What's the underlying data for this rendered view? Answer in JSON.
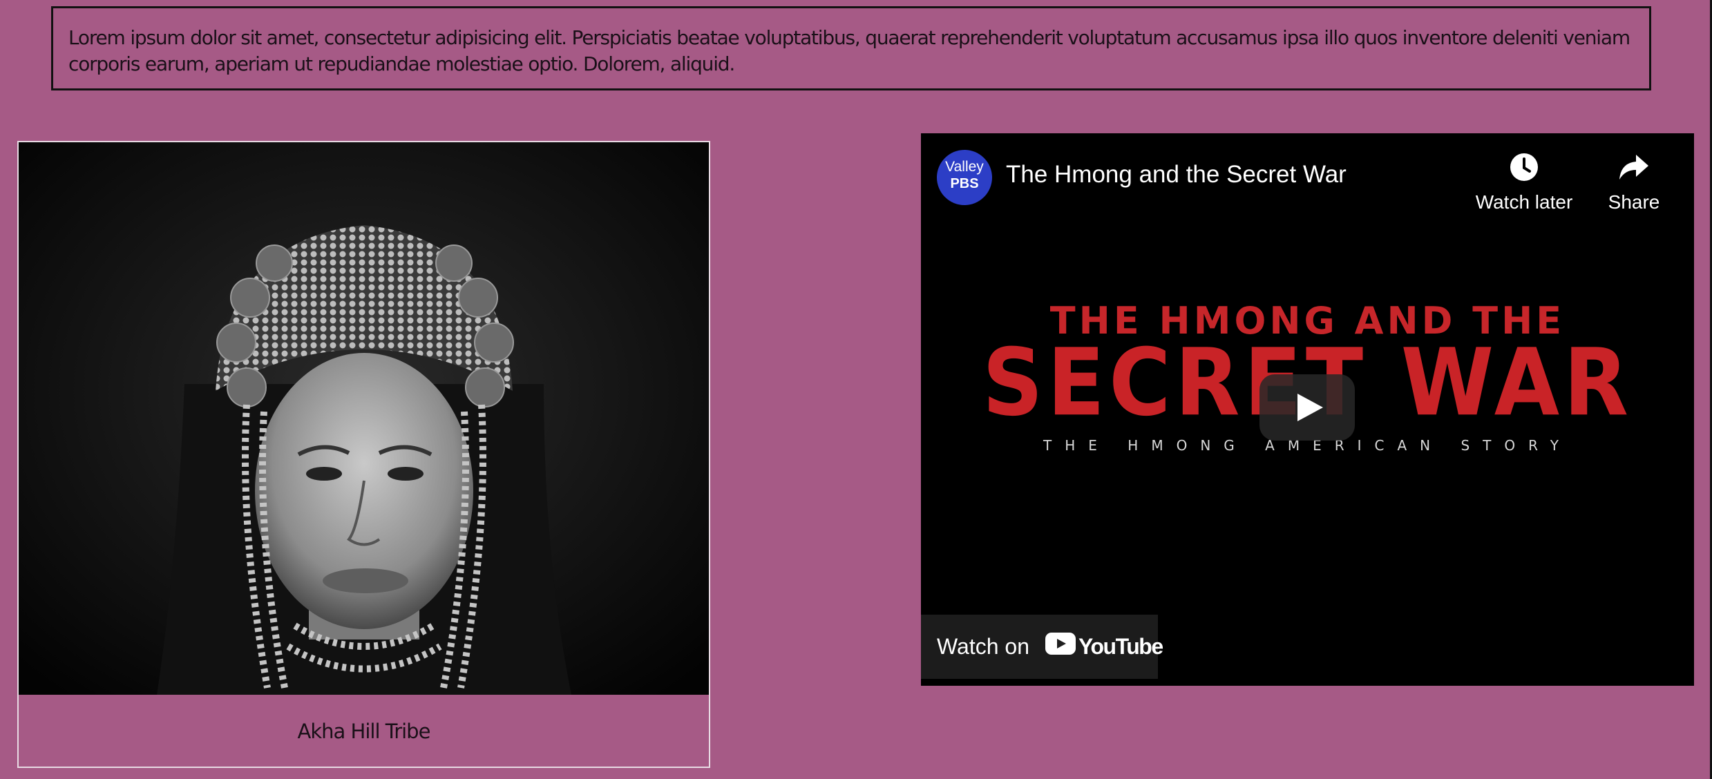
{
  "intro": {
    "text": "Lorem ipsum dolor sit amet, consectetur adipisicing elit. Perspiciatis beatae voluptatibus, quaerat reprehenderit voluptatum accusamus ipsa illo quos inventore deleniti veniam corporis earum, aperiam ut repudiandae molestiae optio. Dolorem, aliquid."
  },
  "figure": {
    "photo_subject": "black and white portrait of a woman in a beaded Akha headdress",
    "caption": "Akha Hill Tribe"
  },
  "video": {
    "channel_logo_line1": "Valley",
    "channel_logo_line2": "PBS",
    "title": "The Hmong and the Secret War",
    "watch_later_label": "Watch later",
    "share_label": "Share",
    "poster_line1": "THE HMONG AND THE",
    "poster_line2": "SECRET WAR",
    "poster_line3": "THE HMONG AMERICAN STORY",
    "watch_on_label": "Watch on",
    "youtube_label": "YouTube"
  },
  "colors": {
    "page_background": "#a65a86",
    "poster_red": "#c92327",
    "pbs_blue": "#2c3ec6",
    "youtube_red": "#ff0000"
  },
  "icons": [
    "clock-icon",
    "share-arrow-icon",
    "play-icon",
    "youtube-logo-icon"
  ]
}
